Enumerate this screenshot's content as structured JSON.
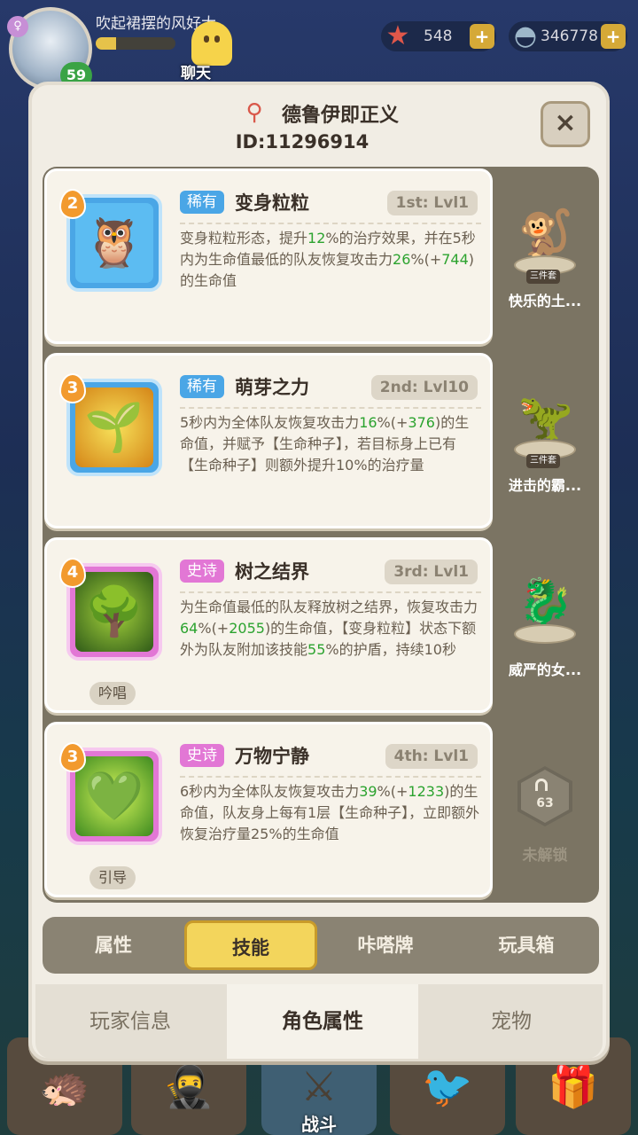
{
  "hud": {
    "player_name": "吹起裙摆的风好大",
    "avatar_level": "59",
    "exp_fraction": 0.25,
    "chat_label": "聊天",
    "star_icon": "star-icon",
    "star_count": "548",
    "shell_icon": "shell-icon",
    "shell_count": "346778",
    "plus": "+"
  },
  "panel": {
    "title": "德鲁伊即正义",
    "id": "ID:11296914",
    "close": "×"
  },
  "skills": [
    {
      "level": "2",
      "rarity": "稀有",
      "name": "变身粒粒",
      "lvl": "1st: Lvl1",
      "desc": "变身粒粒形态，提升12%的治疗效果，并在5秒内为生命值最低的队友恢复攻击力26%(+744)的生命值",
      "type": ""
    },
    {
      "level": "3",
      "rarity": "稀有",
      "name": "萌芽之力",
      "lvl": "2nd: Lvl10",
      "desc": "5秒内为全体队友恢复攻击力16%(+376)的生命值，并赋予【生命种子】，若目标身上已有【生命种子】则额外提升10%的治疗量",
      "type": ""
    },
    {
      "level": "4",
      "rarity": "史诗",
      "name": "树之结界",
      "lvl": "3rd: Lvl1",
      "desc": "为生命值最低的队友释放树之结界，恢复攻击力64%(+2055)的生命值，【变身粒粒】状态下额外为队友附加该技能55%的护盾，持续10秒",
      "type": "吟唱"
    },
    {
      "level": "3",
      "rarity": "史诗",
      "name": "万物宁静",
      "lvl": "4th: Lvl1",
      "desc": "6秒内为全体队友恢复攻击力39%(+1233)的生命值，队友身上每有1层【生命种子】，立即额外恢复治疗量25%的生命值",
      "type": "引导"
    }
  ],
  "pets": [
    {
      "name": "快乐的土...",
      "tag": "三件套"
    },
    {
      "name": "进击的霸...",
      "tag": "三件套"
    },
    {
      "name": "威严的女...",
      "tag": ""
    },
    {
      "locked": true,
      "lock_level": "63",
      "name": "未解锁"
    }
  ],
  "sub_tabs": [
    "属性",
    "技能",
    "咔嗒牌",
    "玩具箱"
  ],
  "sub_tab_active": 1,
  "main_tabs": [
    "玩家信息",
    "角色属性",
    "宠物"
  ],
  "main_tab_active": 1,
  "bottom_nav": {
    "battle_label": "战斗"
  },
  "colors": {
    "rare": "#4aa6e6",
    "epic": "#e277d5",
    "highlight": "#2ca32f",
    "active_tab": "#f3d55c"
  }
}
